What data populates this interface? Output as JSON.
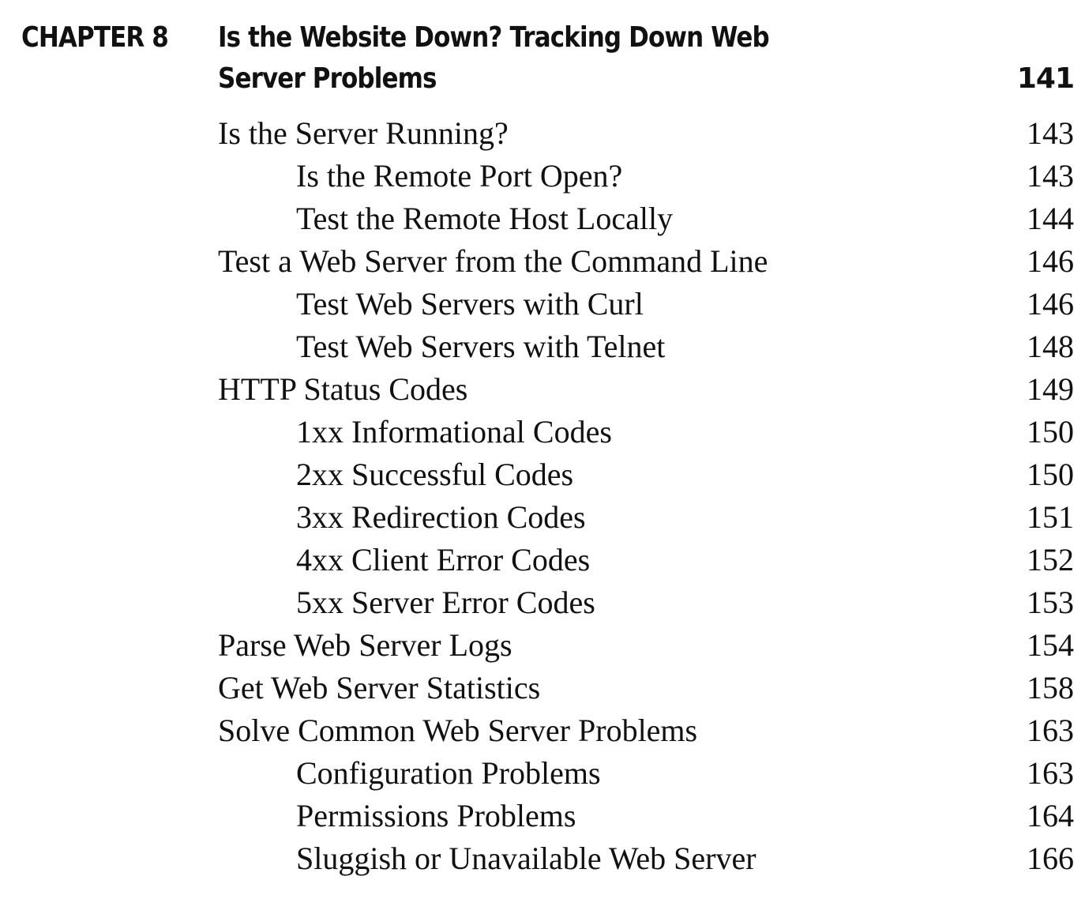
{
  "chapter": {
    "label": "CHAPTER 8",
    "title_line1": "Is the Website Down? Tracking Down Web",
    "title_line2": "Server Problems",
    "page": "141"
  },
  "entries": [
    {
      "title": "Is the Server Running?",
      "page": "143",
      "level": 1
    },
    {
      "title": "Is the Remote Port Open?",
      "page": "143",
      "level": 2
    },
    {
      "title": "Test the Remote Host Locally",
      "page": "144",
      "level": 2
    },
    {
      "title": "Test a Web Server from the Command Line",
      "page": "146",
      "level": 1
    },
    {
      "title": "Test Web Servers with Curl",
      "page": "146",
      "level": 2
    },
    {
      "title": "Test Web Servers with Telnet",
      "page": "148",
      "level": 2
    },
    {
      "title": "HTTP Status Codes",
      "page": "149",
      "level": 1
    },
    {
      "title": "1xx Informational Codes",
      "page": "150",
      "level": 2
    },
    {
      "title": "2xx Successful Codes",
      "page": "150",
      "level": 2
    },
    {
      "title": "3xx Redirection Codes",
      "page": "151",
      "level": 2
    },
    {
      "title": "4xx Client Error Codes",
      "page": "152",
      "level": 2
    },
    {
      "title": "5xx Server Error Codes",
      "page": "153",
      "level": 2
    },
    {
      "title": "Parse Web Server Logs",
      "page": "154",
      "level": 1
    },
    {
      "title": "Get Web Server Statistics",
      "page": "158",
      "level": 1
    },
    {
      "title": "Solve Common Web Server Problems",
      "page": "163",
      "level": 1
    },
    {
      "title": "Configuration Problems",
      "page": "163",
      "level": 2
    },
    {
      "title": "Permissions Problems",
      "page": "164",
      "level": 2
    },
    {
      "title": "Sluggish or Unavailable Web Server",
      "page": "166",
      "level": 2
    }
  ]
}
